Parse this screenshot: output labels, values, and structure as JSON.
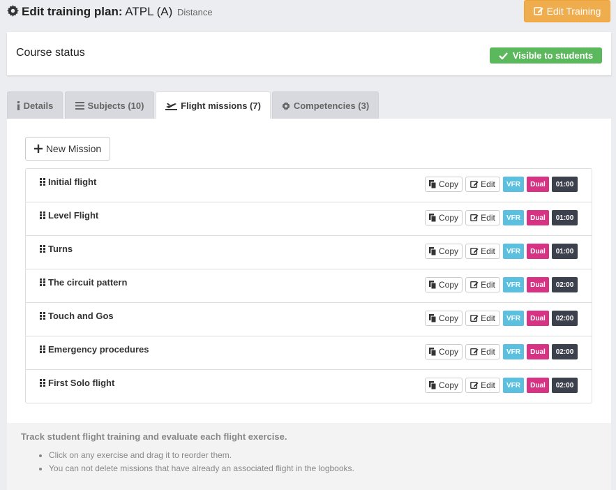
{
  "header": {
    "title_prefix": "Edit training plan:",
    "title_name": "ATPL (A)",
    "title_sub": "Distance",
    "edit_button": "Edit Training"
  },
  "status": {
    "title": "Course status",
    "badge": "Visible to students"
  },
  "tabs": [
    {
      "label": "Details",
      "icon": "info-icon"
    },
    {
      "label": "Subjects (10)",
      "icon": "list-icon"
    },
    {
      "label": "Flight missions (7)",
      "icon": "plane-icon",
      "active": true
    },
    {
      "label": "Competencies (3)",
      "icon": "cog-icon"
    }
  ],
  "panel": {
    "new_mission_label": "New Mission",
    "missions": [
      {
        "name": "Initial flight",
        "copy": "Copy",
        "edit": "Edit",
        "rule": "VFR",
        "type": "Dual",
        "duration": "01:00"
      },
      {
        "name": "Level Flight",
        "copy": "Copy",
        "edit": "Edit",
        "rule": "VFR",
        "type": "Dual",
        "duration": "01:00"
      },
      {
        "name": "Turns",
        "copy": "Copy",
        "edit": "Edit",
        "rule": "VFR",
        "type": "Dual",
        "duration": "01:00"
      },
      {
        "name": "The circuit pattern",
        "copy": "Copy",
        "edit": "Edit",
        "rule": "VFR",
        "type": "Dual",
        "duration": "02:00"
      },
      {
        "name": "Touch and Gos",
        "copy": "Copy",
        "edit": "Edit",
        "rule": "VFR",
        "type": "Dual",
        "duration": "02:00"
      },
      {
        "name": "Emergency procedures",
        "copy": "Copy",
        "edit": "Edit",
        "rule": "VFR",
        "type": "Dual",
        "duration": "02:00"
      },
      {
        "name": "First Solo flight",
        "copy": "Copy",
        "edit": "Edit",
        "rule": "VFR",
        "type": "Dual",
        "duration": "02:00"
      }
    ]
  },
  "info": {
    "title": "Track student flight training and evaluate each flight exercise.",
    "bullets": [
      "Click on any exercise and drag it to reorder them.",
      "You can not delete missions that have already an associated flight in the logbooks."
    ]
  },
  "colors": {
    "warning": "#f0ad4e",
    "success": "#5cb85c",
    "info": "#5bc0de",
    "pink": "#d63384",
    "dark": "#3c3f4c"
  }
}
